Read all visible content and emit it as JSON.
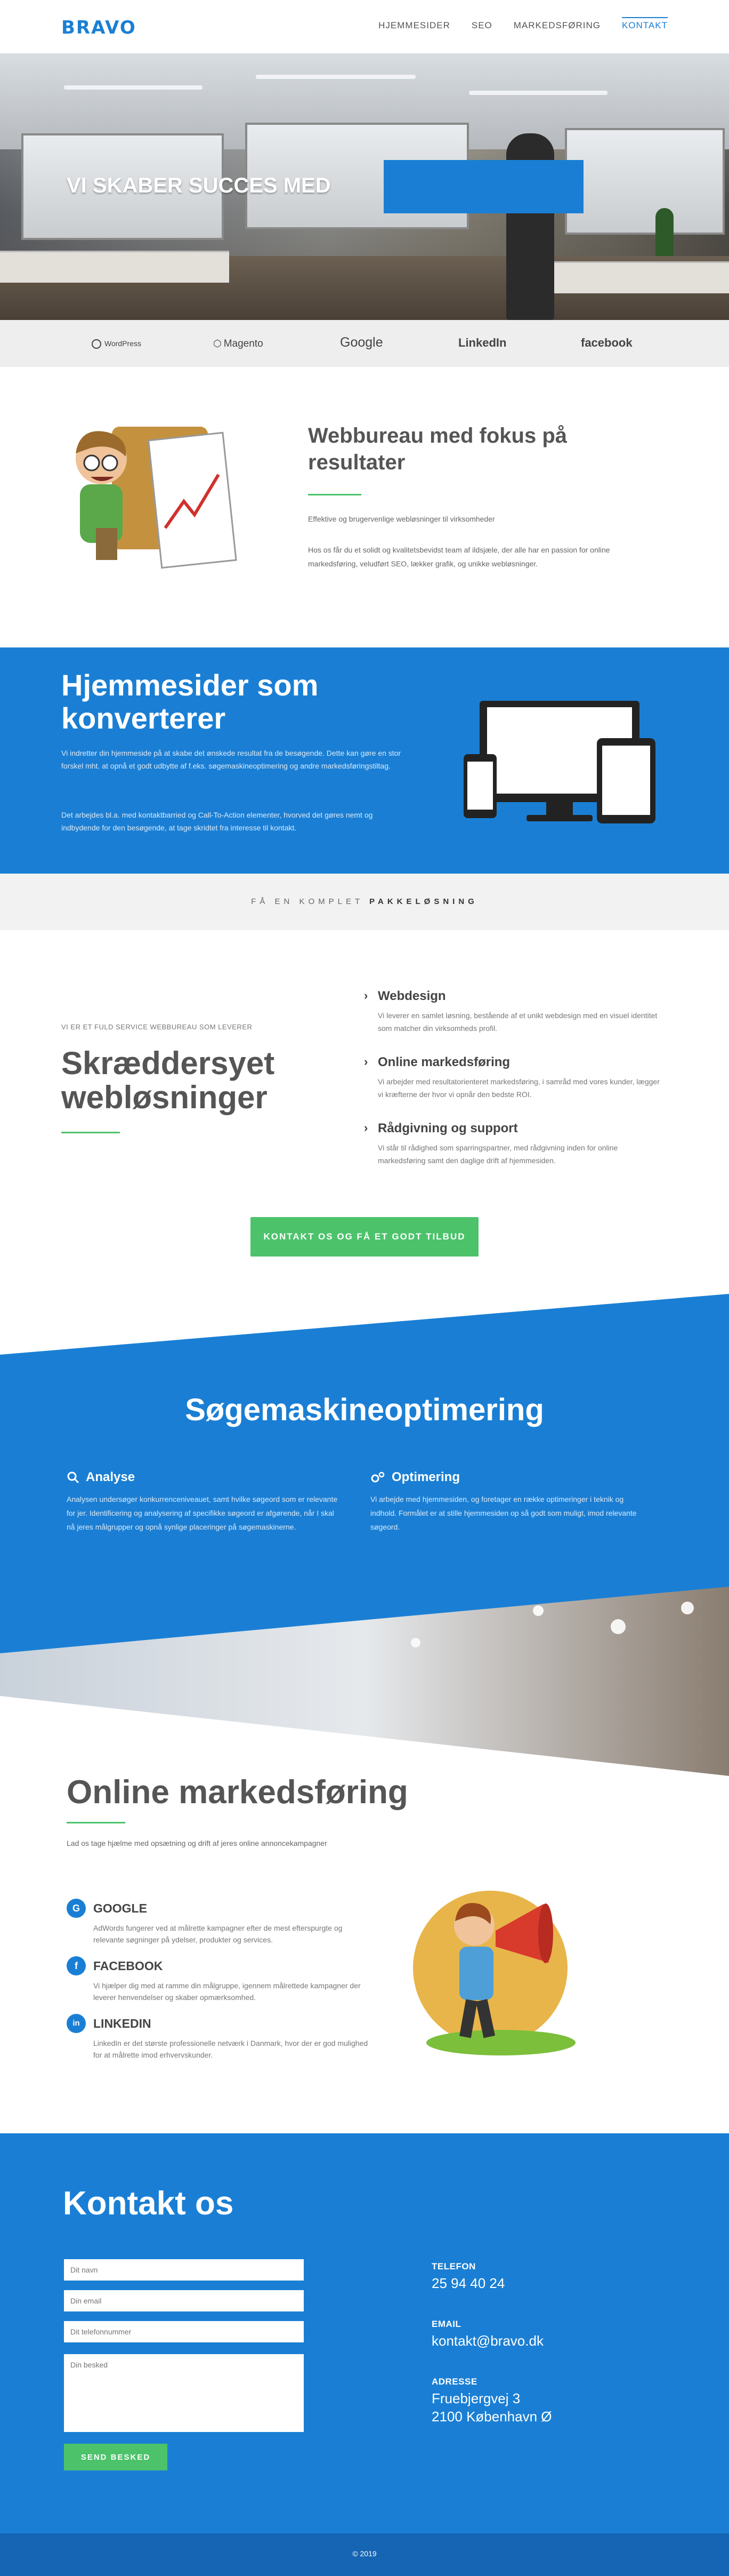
{
  "brand": {
    "logo": "BRAVO",
    "accent": "#1a7fd4",
    "green": "#4cc36b"
  },
  "nav": {
    "items": [
      "HJEMMESIDER",
      "SEO",
      "MARKEDSFØRING",
      "KONTAKT"
    ]
  },
  "hero": {
    "title": "VI SKABER SUCCES MED"
  },
  "logos": [
    "WordPress",
    "Magento",
    "Google",
    "LinkedIn",
    "facebook"
  ],
  "intro": {
    "title": "Webbureau med fokus på resultater",
    "p1": "Effektive og brugervenlige webløsninger til virksomheder",
    "p2": "Hos os får du et solidt og kvalitetsbevidst team af ildsjæle, der alle har en passion for online markedsføring, veludført SEO, lækker grafik, og unikke webløsninger."
  },
  "hjemmesider": {
    "title": "Hjemmesider som konverterer",
    "p1": "Vi indretter din hjemmeside på at skabe det ønskede resultat fra de besøgende. Dette kan gøre en stor forskel mht. at opnå et godt udbytte af f.eks. søgemaskineoptimering og andre markedsføringstiltag.",
    "p2": "Det arbejdes bl.a. med kontaktbarried og Call-To-Action elementer, hvorved det gøres nemt og indbydende for den besøgende, at tage skridtet fra interesse til kontakt."
  },
  "pakke": {
    "prefix": "FÅ EN KOMPLET",
    "strong": "PAKKELØSNING"
  },
  "solutions": {
    "kicker": "VI ER ET FULD SERVICE WEBBUREAU SOM LEVERER",
    "title": "Skræddersyet webløsninger",
    "features": [
      {
        "title": "Webdesign",
        "desc": "Vi leverer en samlet løsning, bestående af et unikt webdesign med en visuel identitet som matcher din virksomheds profil."
      },
      {
        "title": "Online markedsføring",
        "desc": "Vi arbejder med resultatorienteret markedsføring, i samråd med vores kunder, lægger vi kræfterne der hvor vi opnår den bedste ROI."
      },
      {
        "title": "Rådgivning og support",
        "desc": "Vi står til rådighed som sparringspartner, med rådgivning inden for online markedsføring samt den daglige drift af hjemmesiden."
      }
    ],
    "cta": "KONTAKT OS OG FÅ ET GODT TILBUD"
  },
  "seo": {
    "title": "Søgemaskineoptimering",
    "cols": [
      {
        "title": "Analyse",
        "icon": "search-icon",
        "desc": "Analysen undersøger konkurrenceniveauet, samt hvilke søgeord som er relevante for jer. Identificering og analysering af specifikke søgeord er afgørende, når I skal nå jeres målgrupper og opnå synlige placeringer på søgemaskinerne."
      },
      {
        "title": "Optimering",
        "icon": "gears-icon",
        "desc": "Vi arbejde med hjemmesiden, og foretager en række optimeringer i teknik og indhold. Formålet er at stille hjemmesiden op så godt som muligt, imod relevante søgeord."
      }
    ]
  },
  "online": {
    "title": "Online markedsføring",
    "intro": "Lad os tage hjælme med opsætning og drift af jeres online annoncekampagner",
    "items": [
      {
        "icon": "G",
        "title": "GOOGLE",
        "desc": "AdWords fungerer ved at målrette kampagner efter de mest efterspurgte og relevante søgninger på ydelser, produkter og services."
      },
      {
        "icon": "f",
        "title": "FACEBOOK",
        "desc": "Vi hjælper dig med at ramme din målgruppe, igennem målrettede kampagner der leverer henvendelser og skaber opmærksomhed."
      },
      {
        "icon": "in",
        "title": "LINKEDIN",
        "desc": "LinkedIn er det største professionelle netværk i Danmark, hvor der er god mulighed for at målrette imod erhvervskunder."
      }
    ]
  },
  "kontakt": {
    "title": "Kontakt os",
    "fields": {
      "name": "Dit navn",
      "email": "Din email",
      "phone": "Dit telefonnummer",
      "message": "Din besked"
    },
    "send": "SEND BESKED",
    "telefon_label": "TELEFON",
    "telefon": "25 94 40 24",
    "email_label": "EMAIL",
    "email": "kontakt@bravo.dk",
    "adresse_label": "ADRESSE",
    "adresse1": "Fruebjergvej 3",
    "adresse2": "2100 København Ø"
  },
  "footer": {
    "text": "© 2019"
  }
}
